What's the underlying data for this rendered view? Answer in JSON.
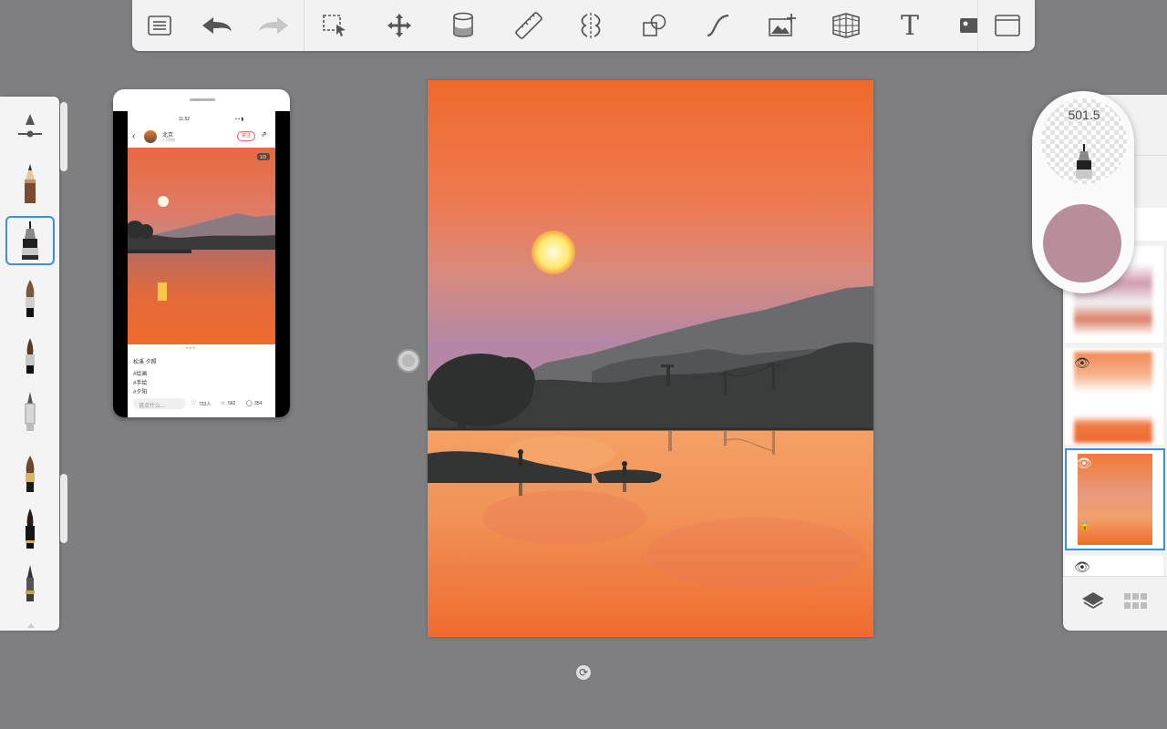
{
  "toolbar": {
    "icons": [
      "menu-icon",
      "undo-icon",
      "redo-icon",
      "selection-icon",
      "transform-icon",
      "fill-icon",
      "ruler-icon",
      "symmetry-icon",
      "shapes-icon",
      "curve-icon",
      "add-image-icon",
      "perspective-icon",
      "text-icon",
      "reference-icon",
      "fullscreen-icon"
    ],
    "text_tool_label": "T"
  },
  "brush_size": "501.5",
  "current_color": "#b98e9b",
  "reference": {
    "status_time": "11:52",
    "author_name": "北京",
    "author_sub": "2小时前",
    "follow_label": "关注",
    "page_indicator": "1/3",
    "post_title": "松溪 夕照",
    "post_line1": "#绘画",
    "post_line2": "#手绘",
    "post_line3": "#夕阳",
    "comment_placeholder": "说点什么...",
    "likes": "733人",
    "stars": "562",
    "comments": "354"
  },
  "colors": {
    "accent": "#3b8fe0",
    "sky_top": "#ee6a2e",
    "sky_mid": "#e98a66",
    "sky_purple": "#b487a6",
    "water": "#f08a4a"
  }
}
